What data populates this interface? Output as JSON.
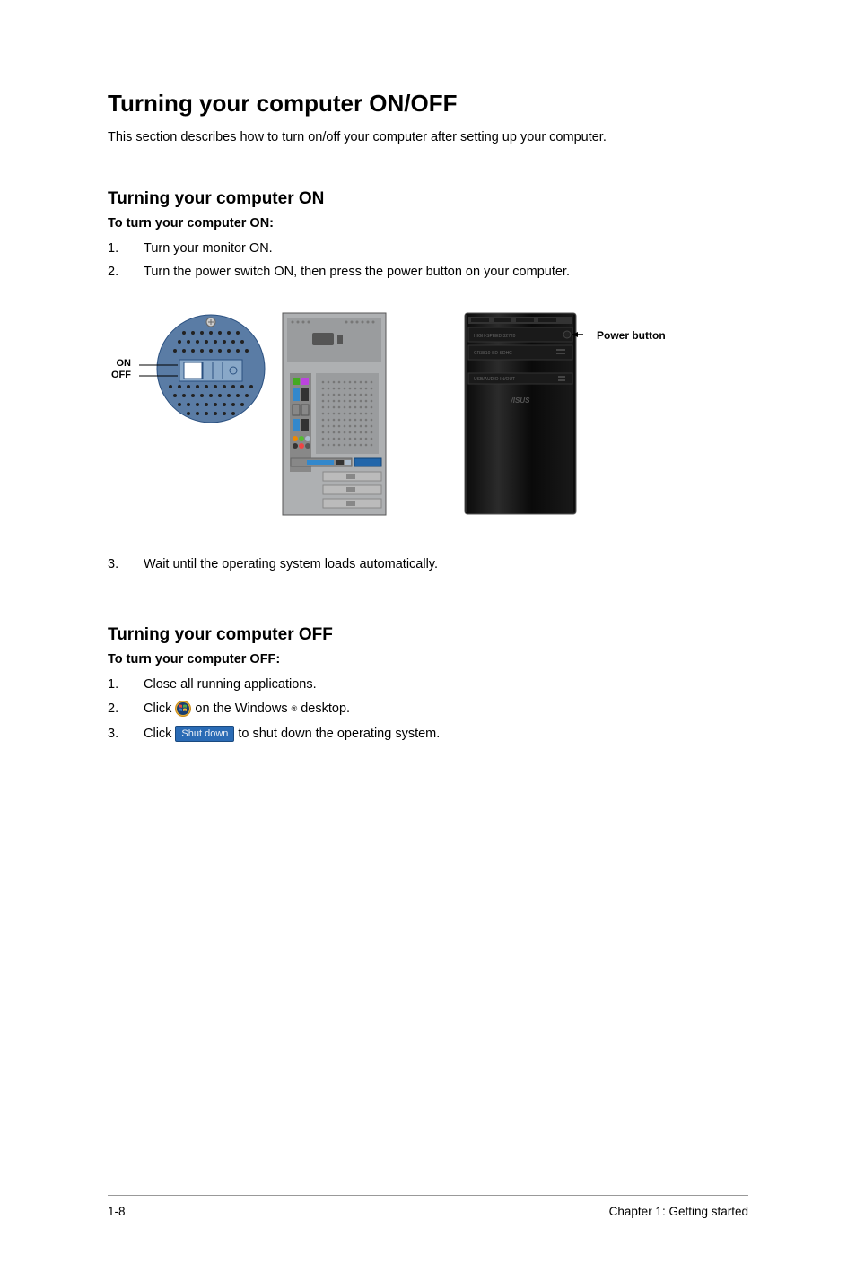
{
  "heading": "Turning your computer ON/OFF",
  "intro": "This section describes how to turn on/off your computer after setting up your computer.",
  "section_on": {
    "heading": "Turning your computer ON",
    "subhead": "To turn your computer ON:",
    "steps": {
      "s1_num": "1.",
      "s1_text": "Turn your monitor ON.",
      "s2_num": "2.",
      "s2_text": "Turn the power switch ON, then press the power button on your computer.",
      "s3_num": "3.",
      "s3_text": "Wait until the operating system loads automatically."
    },
    "labels": {
      "on": "ON",
      "off": "OFF",
      "power_button": "Power button"
    }
  },
  "section_off": {
    "heading": "Turning your computer OFF",
    "subhead": "To turn your computer OFF:",
    "steps": {
      "s1_num": "1.",
      "s1_text": "Close all running applications.",
      "s2_num": "2.",
      "s2_text_a": "Click",
      "s2_text_b": "on the Windows",
      "s2_reg": "®",
      "s2_text_c": "desktop.",
      "s3_num": "3.",
      "s3_text_a": "Click",
      "s3_btn": "Shut down",
      "s3_text_b": "to shut down the operating system."
    }
  },
  "footer": {
    "page": "1-8",
    "chapter": "Chapter 1: Getting started"
  }
}
